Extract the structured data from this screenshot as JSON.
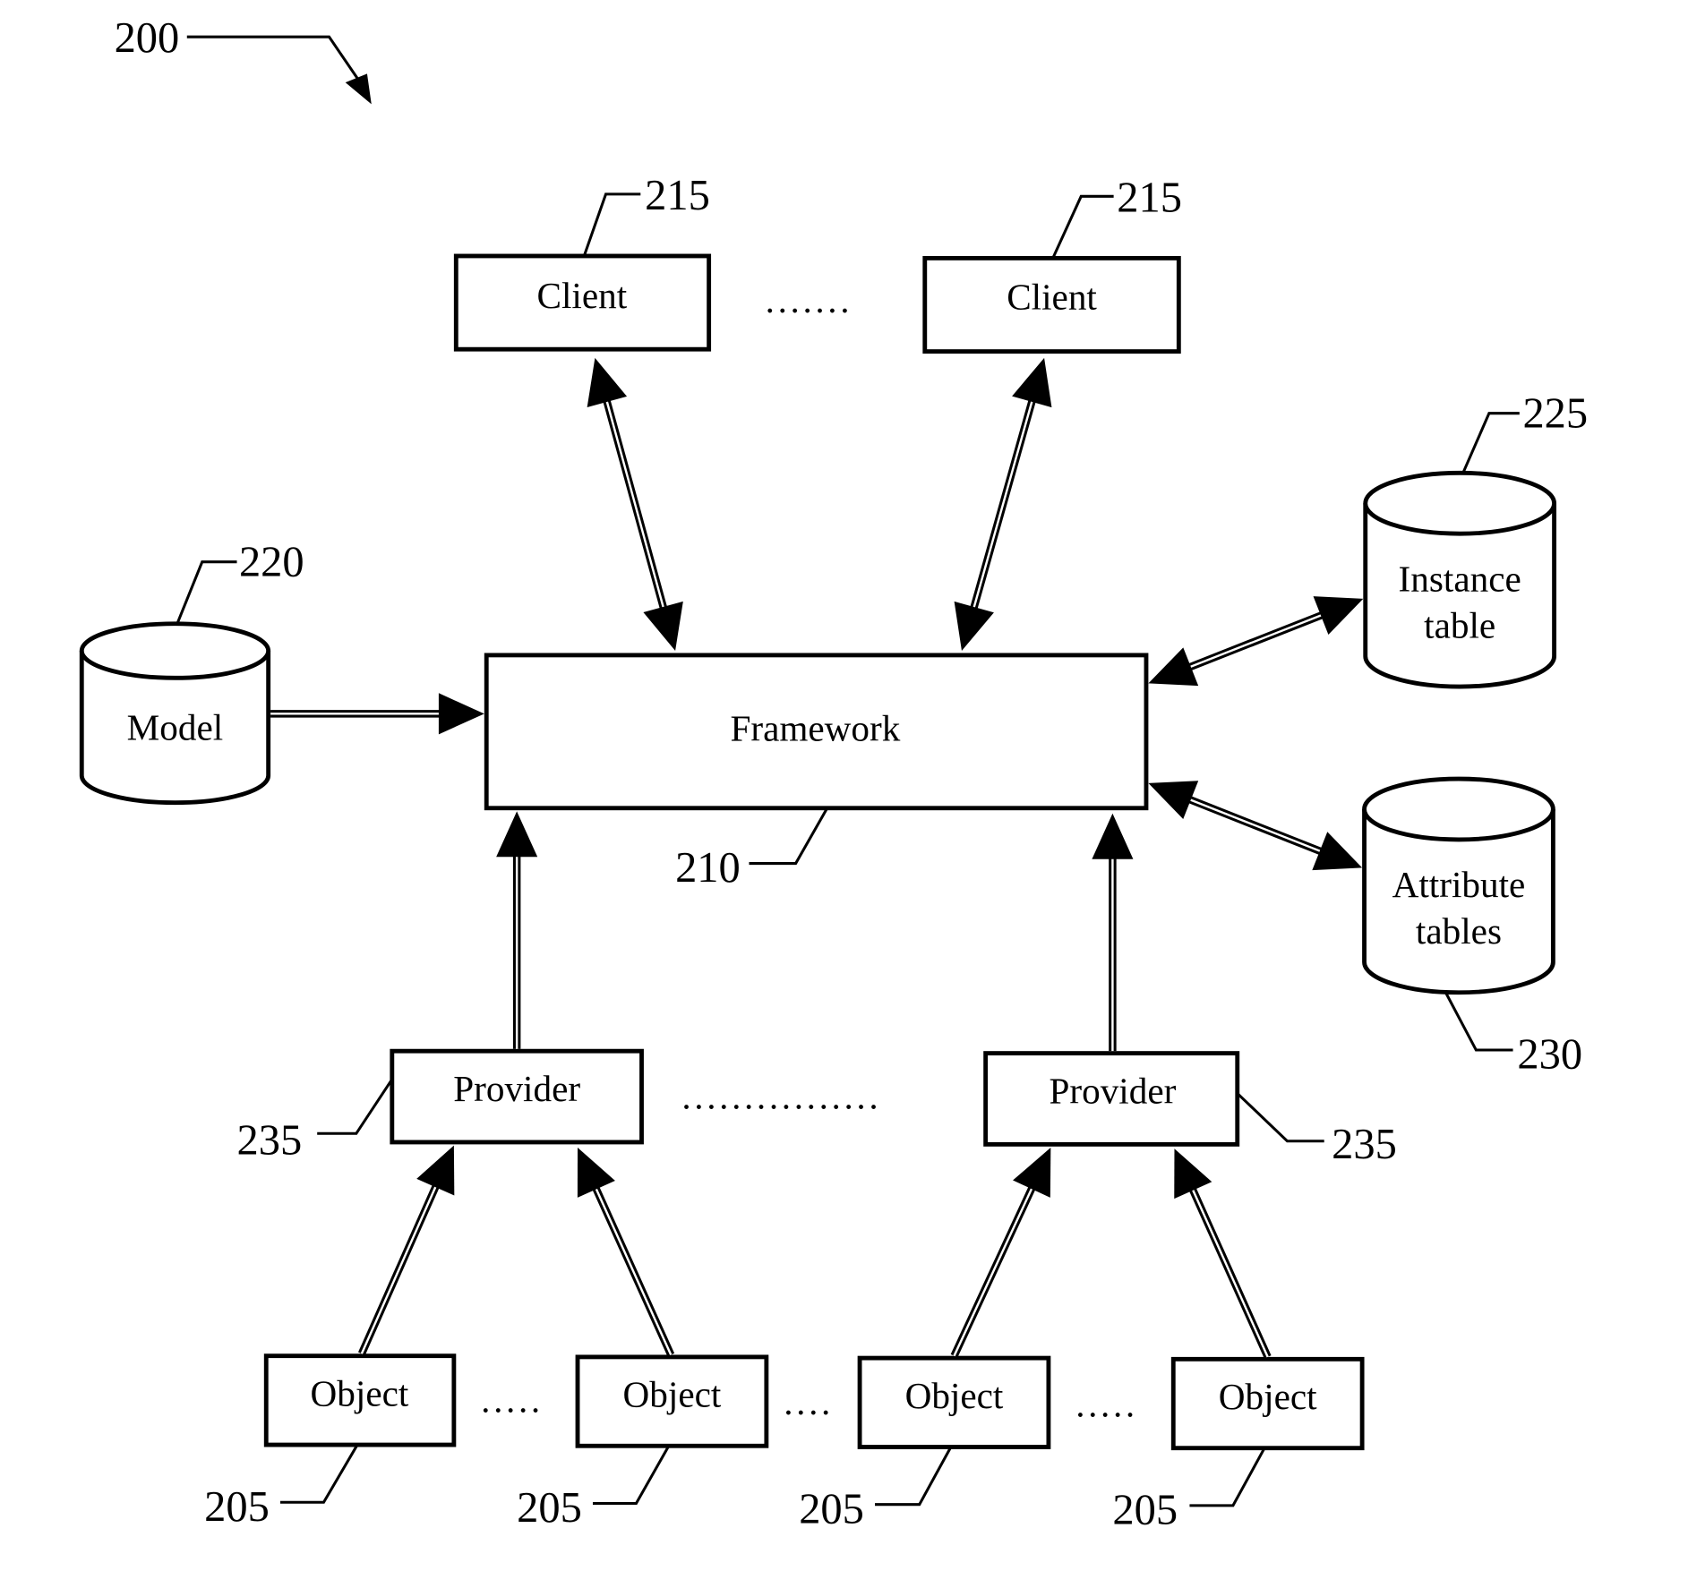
{
  "figure": {
    "ref": "200"
  },
  "nodes": {
    "client_left": {
      "label": "Client",
      "ref": "215"
    },
    "client_right": {
      "label": "Client",
      "ref": "215"
    },
    "model": {
      "label": "Model",
      "ref": "220"
    },
    "framework": {
      "label": "Framework",
      "ref": "210"
    },
    "instance_table": {
      "label_line1": "Instance",
      "label_line2": "table",
      "ref": "225"
    },
    "attribute_tables": {
      "label_line1": "Attribute",
      "label_line2": "tables",
      "ref": "230"
    },
    "provider_left": {
      "label": "Provider",
      "ref": "235"
    },
    "provider_right": {
      "label": "Provider",
      "ref": "235"
    },
    "objects": [
      {
        "label": "Object",
        "ref": "205"
      },
      {
        "label": "Object",
        "ref": "205"
      },
      {
        "label": "Object",
        "ref": "205"
      },
      {
        "label": "Object",
        "ref": "205"
      }
    ]
  },
  "ellipses": {
    "clients": ".......",
    "providers": "................",
    "objects_1": ".....",
    "objects_2": "....",
    "objects_3": "....."
  },
  "edges": [
    {
      "from": "client_left",
      "to": "framework",
      "direction": "bidirectional"
    },
    {
      "from": "client_right",
      "to": "framework",
      "direction": "bidirectional"
    },
    {
      "from": "model",
      "to": "framework",
      "direction": "forward"
    },
    {
      "from": "framework",
      "to": "instance_table",
      "direction": "bidirectional"
    },
    {
      "from": "framework",
      "to": "attribute_tables",
      "direction": "bidirectional"
    },
    {
      "from": "provider_left",
      "to": "framework",
      "direction": "forward"
    },
    {
      "from": "provider_right",
      "to": "framework",
      "direction": "forward"
    },
    {
      "from": "objects.0",
      "to": "provider_left",
      "direction": "forward"
    },
    {
      "from": "objects.1",
      "to": "provider_left",
      "direction": "forward"
    },
    {
      "from": "objects.2",
      "to": "provider_right",
      "direction": "forward"
    },
    {
      "from": "objects.3",
      "to": "provider_right",
      "direction": "forward"
    }
  ]
}
